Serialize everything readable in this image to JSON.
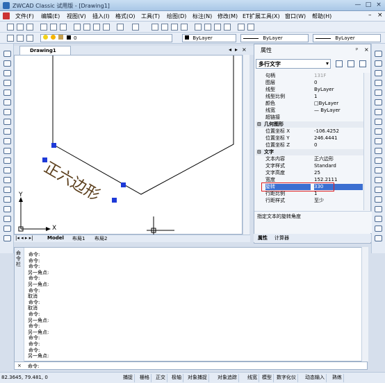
{
  "window": {
    "title": "ZWCAD Classic 试用版 - [Drawing1]",
    "controls": [
      "—",
      "□",
      "×"
    ],
    "doc_controls": [
      "–",
      "×"
    ]
  },
  "menu": [
    "文件(F)",
    "编辑(E)",
    "视图(V)",
    "插入(I)",
    "格式(O)",
    "工具(T)",
    "绘图(D)",
    "标注(N)",
    "修改(M)",
    "ET扩展工具(X)",
    "窗口(W)",
    "帮助(H)"
  ],
  "toolbar": {
    "layer_value": "0",
    "color_value": "ByLayer",
    "linetype_value": "ByLayer",
    "lineweight_value": "ByLayer"
  },
  "drawing": {
    "tab_label": "Drawing1",
    "tab_controls": [
      "◂",
      "▸",
      "×"
    ],
    "text_content": "正六边形",
    "ucs_x": "X",
    "ucs_y": "Y",
    "layout_tabs": [
      "Model",
      "布局1",
      "布局2"
    ]
  },
  "properties": {
    "title": "属性",
    "title_controls": [
      "ᵖ",
      "×"
    ],
    "selected_type": "多行文字",
    "rows": [
      {
        "k": "句柄",
        "v": "131F",
        "gray": true
      },
      {
        "k": "图层",
        "v": "0"
      },
      {
        "k": "线型",
        "v": "ByLayer"
      },
      {
        "k": "线型比例",
        "v": "1"
      },
      {
        "k": "颜色",
        "v": "□ByLayer"
      },
      {
        "k": "线宽",
        "v": "— ByLayer"
      },
      {
        "k": "超链接",
        "v": ""
      },
      {
        "k": "几何图形",
        "v": "",
        "section": true
      },
      {
        "k": "位置坐标 X",
        "v": "-106.4252"
      },
      {
        "k": "位置坐标 Y",
        "v": "246.4441"
      },
      {
        "k": "位置坐标 Z",
        "v": "0"
      },
      {
        "k": "文字",
        "v": "",
        "section": true
      },
      {
        "k": "文本内容",
        "v": "正六边形"
      },
      {
        "k": "文字样式",
        "v": "Standard"
      },
      {
        "k": "文字高度",
        "v": "25"
      },
      {
        "k": "宽度",
        "v": "152.2111"
      },
      {
        "k": "旋转",
        "v": "330",
        "highlight": true
      },
      {
        "k": "行距比例",
        "v": "1"
      },
      {
        "k": "行距样式",
        "v": "至少"
      }
    ],
    "description": "指定文本的旋转角度",
    "tabs": [
      "属性",
      "计算器"
    ]
  },
  "command": {
    "gutter_label": "命令栏",
    "lines": [
      "命令:",
      "命令:",
      "命令:",
      "另一角点:",
      "命令:",
      "另一角点:",
      "命令:",
      "取消",
      "命令:",
      "取消",
      "命令:",
      "另一角点:",
      "命令:",
      "另一角点:",
      "命令:",
      "命令:",
      "命令:",
      "另一角点:"
    ],
    "prompt": "命令:"
  },
  "status": {
    "coords": "82.3645,  79.481,  0",
    "buttons": [
      "捕捉",
      "栅格",
      "正交",
      "极轴",
      "对象捕捉",
      "对象追踪",
      "线宽",
      "模型",
      "数字化仪",
      "动态输入",
      "熟练"
    ]
  }
}
